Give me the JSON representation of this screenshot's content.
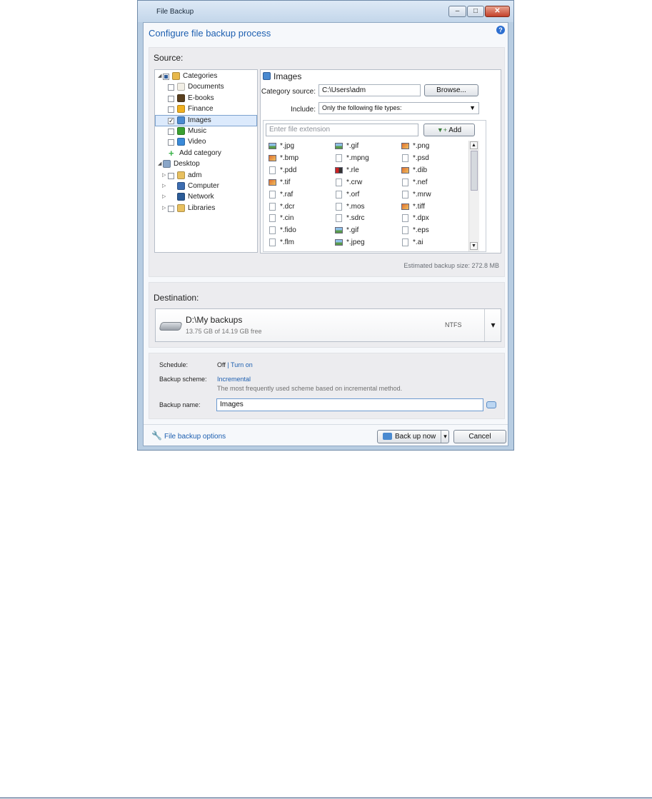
{
  "window": {
    "title": "File Backup",
    "heading": "Configure file backup process",
    "min_label": "–",
    "max_label": "□",
    "close_label": "✕",
    "help_label": "?"
  },
  "source": {
    "title": "Source:",
    "tree": [
      {
        "label": "Categories",
        "level": 0,
        "expand": "◢",
        "checkbox": "partial",
        "icon": "categories-icon",
        "color": "#e8b84a"
      },
      {
        "label": "Documents",
        "level": 1,
        "checkbox": "empty",
        "icon": "documents-icon",
        "color": "#f2efe6"
      },
      {
        "label": "E-books",
        "level": 1,
        "checkbox": "empty",
        "icon": "ebooks-icon",
        "color": "#5a4020"
      },
      {
        "label": "Finance",
        "level": 1,
        "checkbox": "empty",
        "icon": "finance-icon",
        "color": "#f0b020"
      },
      {
        "label": "Images",
        "level": 1,
        "checkbox": "checked",
        "icon": "images-icon",
        "color": "#4a8ad0",
        "selected": true
      },
      {
        "label": "Music",
        "level": 1,
        "checkbox": "empty",
        "icon": "music-icon",
        "color": "#3aa030"
      },
      {
        "label": "Video",
        "level": 1,
        "checkbox": "empty",
        "icon": "video-icon",
        "color": "#3a8ad8"
      },
      {
        "label": "Add category",
        "level": 1,
        "checkbox": "none",
        "icon": "add-icon",
        "color": "#3bb34a"
      },
      {
        "label": "Desktop",
        "level": 0,
        "expand": "◢",
        "checkbox": "none",
        "icon": "desktop-icon",
        "color": "#8aa6c8"
      },
      {
        "label": "adm",
        "level": 1,
        "expand": "▷",
        "checkbox": "empty",
        "icon": "user-folder-icon",
        "color": "#e8c060"
      },
      {
        "label": "Computer",
        "level": 1,
        "expand": "▷",
        "checkbox": "none",
        "icon": "computer-icon",
        "color": "#3c6cb0"
      },
      {
        "label": "Network",
        "level": 1,
        "expand": "▷",
        "checkbox": "none",
        "icon": "network-icon",
        "color": "#2c5c98"
      },
      {
        "label": "Libraries",
        "level": 1,
        "expand": "▷",
        "checkbox": "empty",
        "icon": "libraries-icon",
        "color": "#e8c060"
      }
    ],
    "detail": {
      "title": "Images",
      "category_source_label": "Category source:",
      "category_source_value": "C:\\Users\\adm",
      "browse_label": "Browse...",
      "include_label": "Include:",
      "include_value": "Only the following file types:",
      "ext_placeholder": "Enter file extension",
      "add_label": "Add",
      "extensions": [
        {
          "name": "*.jpg",
          "icon": "photo"
        },
        {
          "name": "*.gif",
          "icon": "photo"
        },
        {
          "name": "*.png",
          "icon": "image"
        },
        {
          "name": "*.bmp",
          "icon": "image"
        },
        {
          "name": "*.mpng",
          "icon": "doc"
        },
        {
          "name": "*.psd",
          "icon": "doc"
        },
        {
          "name": "*.pdd",
          "icon": "doc"
        },
        {
          "name": "*.rle",
          "icon": "rle"
        },
        {
          "name": "*.dib",
          "icon": "image"
        },
        {
          "name": "*.tif",
          "icon": "image"
        },
        {
          "name": "*.crw",
          "icon": "doc"
        },
        {
          "name": "*.nef",
          "icon": "doc"
        },
        {
          "name": "*.raf",
          "icon": "doc"
        },
        {
          "name": "*.orf",
          "icon": "doc"
        },
        {
          "name": "*.mrw",
          "icon": "doc"
        },
        {
          "name": "*.dcr",
          "icon": "doc"
        },
        {
          "name": "*.mos",
          "icon": "doc"
        },
        {
          "name": "*.tiff",
          "icon": "image"
        },
        {
          "name": "*.cin",
          "icon": "doc"
        },
        {
          "name": "*.sdrc",
          "icon": "doc"
        },
        {
          "name": "*.dpx",
          "icon": "doc"
        },
        {
          "name": "*.fido",
          "icon": "doc"
        },
        {
          "name": "*.gif",
          "icon": "photo"
        },
        {
          "name": "*.eps",
          "icon": "doc"
        },
        {
          "name": "*.flm",
          "icon": "doc"
        },
        {
          "name": "*.jpeg",
          "icon": "photo"
        },
        {
          "name": "*.ai",
          "icon": "doc"
        }
      ]
    },
    "estimated_size": "Estimated backup size: 272.8 MB"
  },
  "destination": {
    "title": "Destination:",
    "path": "D:\\My backups",
    "free": "13.75 GB of 14.19 GB free",
    "fs": "NTFS",
    "arrow": "▾"
  },
  "settings": {
    "schedule_label": "Schedule:",
    "schedule_value": "Off",
    "schedule_sep": " | ",
    "schedule_link": "Turn on",
    "scheme_label": "Backup scheme:",
    "scheme_value": "Incremental",
    "scheme_desc": "The most frequently used scheme based on incremental method.",
    "name_label": "Backup name:",
    "name_value": "Images"
  },
  "footer": {
    "options_link": "File backup options",
    "backup_now": "Back up now",
    "backup_arrow": "▾",
    "cancel": "Cancel"
  },
  "colors": {
    "accent": "#1d5fb0",
    "selected_bg": "#dceafc",
    "selected_border": "#7da2ce"
  }
}
